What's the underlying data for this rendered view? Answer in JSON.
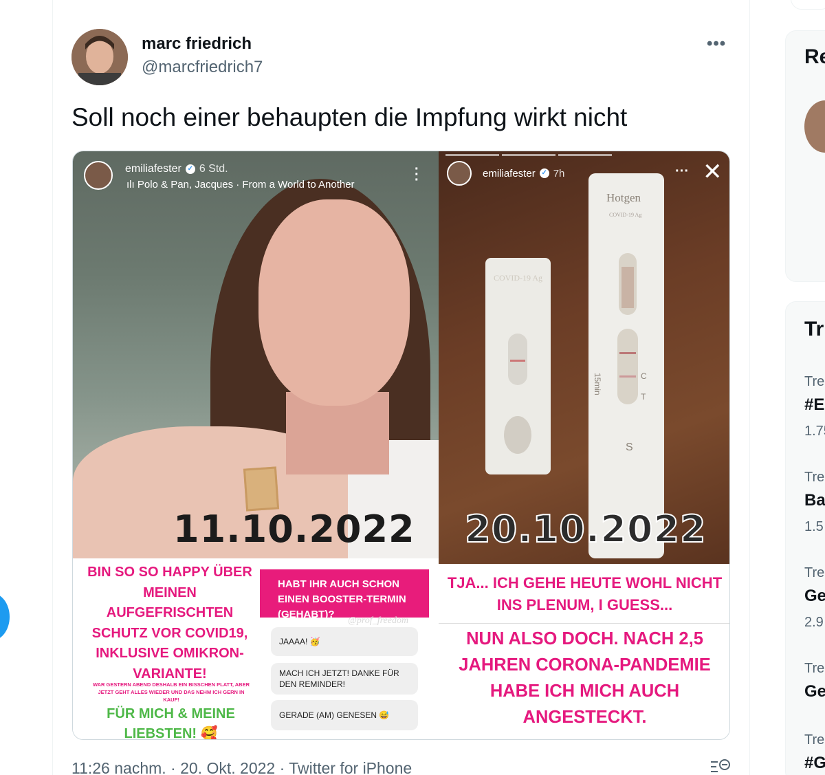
{
  "tweet": {
    "author_name": "marc friedrich",
    "author_handle": "@marcfriedrich7",
    "more_icon": "•••",
    "text": "Soll noch einer behaupten die Impfung wirkt nicht",
    "footer": "11:26 nachm. · 20. Okt. 2022 · Twitter for iPhone"
  },
  "media": {
    "left": {
      "username": "emiliafester",
      "time": "6 Std.",
      "music": "Polo & Pan, Jacques · From a World to Another",
      "date": "11.10.2022",
      "pink_text": "BIN SO SO HAPPY ÜBER MEINEN AUFGEFRISCHTEN SCHUTZ VOR COVID19, INKLUSIVE OMIKRON-VARIANTE!",
      "fine_print": "WAR GESTERN ABEND DESHALB EIN BISSCHEN PLATT, ABER JETZT GEHT ALLES WIEDER UND DAS NEHM ICH GERN IN KAUF!",
      "green_text": "FÜR MICH & MEINE LIEBSTEN! 🥰",
      "question": "HABT IHR AUCH SCHON EINEN BOOSTER-TERMIN (GEHABT)?",
      "watermark": "@prof_freedom",
      "replies": [
        "JAAAA! 🥳",
        "MACH ICH JETZT! DANKE FÜR DEN REMINDER!",
        "GERADE (AM) GENESEN 😅"
      ]
    },
    "right": {
      "username": "emiliafester",
      "time": "7h",
      "more": "···",
      "close": "✕",
      "date": "20.10.2022",
      "text1": "TJA... ICH GEHE HEUTE WOHL NICHT INS PLENUM, I GUESS...",
      "text2": "NUN ALSO DOCH. NACH 2,5 JAHREN CORONA-PANDEMIE HABE ICH MICH AUCH ANGESTECKT.",
      "test1_label": "COVID-19 Ag",
      "test2_brand": "Hotgen",
      "test2_label": "COVID-19 Ag",
      "test2_min": "15min",
      "ct": "C  T",
      "s": "S"
    }
  },
  "sidebar": {
    "section1_heading": "Re",
    "section2_heading": "Tr",
    "trends": [
      {
        "label": "Tre",
        "tag": "#E",
        "count": "1.75"
      },
      {
        "label": "Tre",
        "tag": "Ba",
        "count": "1.5"
      },
      {
        "label": "Tre",
        "tag": "Ge",
        "count": "2.9"
      },
      {
        "label": "Tre",
        "tag": "Ge",
        "count": ""
      },
      {
        "label": "Tre",
        "tag": "#G",
        "count": ""
      }
    ]
  }
}
